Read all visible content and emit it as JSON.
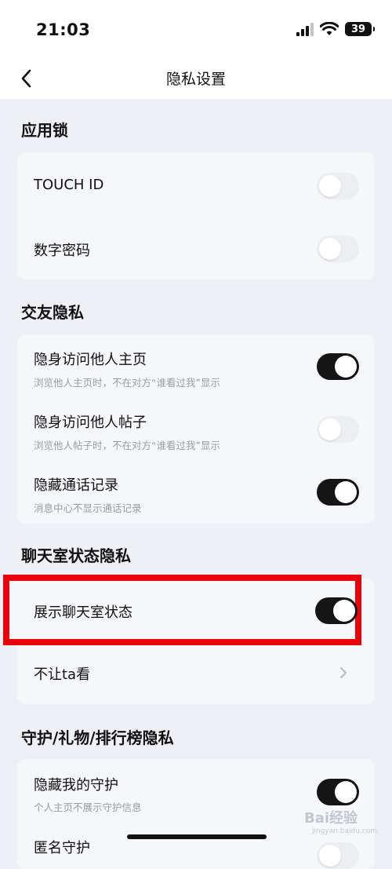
{
  "status": {
    "time": "21:03",
    "battery": "39"
  },
  "nav": {
    "title": "隐私设置"
  },
  "sections": [
    {
      "title": "应用锁"
    },
    {
      "title": "交友隐私"
    },
    {
      "title": "聊天室状态隐私"
    },
    {
      "title": "守护/礼物/排行榜隐私"
    }
  ],
  "app_lock": {
    "touch_id": {
      "title": "TOUCH ID",
      "on": false
    },
    "pin": {
      "title": "数字密码",
      "on": false
    }
  },
  "friend_privacy": {
    "invisible_home": {
      "title": "隐身访问他人主页",
      "subtitle": "浏览他人主页时，不在对方“谁看过我”显示",
      "on": true
    },
    "invisible_posts": {
      "title": "隐身访问他人帖子",
      "subtitle": "浏览他人帖子时，不在对方“谁看过我”显示",
      "on": false
    },
    "hide_calls": {
      "title": "隐藏通话记录",
      "subtitle": "消息中心不显示通话记录",
      "on": true
    }
  },
  "chatroom_privacy": {
    "show_status": {
      "title": "展示聊天室状态",
      "on": true
    },
    "hide_from": {
      "title": "不让ta看"
    }
  },
  "guard_privacy": {
    "hide_guard": {
      "title": "隐藏我的守护",
      "subtitle": "个人主页不展示守护信息",
      "on": true
    },
    "anonymous_guard": {
      "title": "匿名守护"
    }
  },
  "watermark": {
    "text": "Bai经验",
    "sub": "jingyan.baidu.com"
  },
  "colors": {
    "toggle_on": "#151515",
    "toggle_off": "#eceef2",
    "highlight": "#e8000b",
    "background": "#eef0f5"
  }
}
